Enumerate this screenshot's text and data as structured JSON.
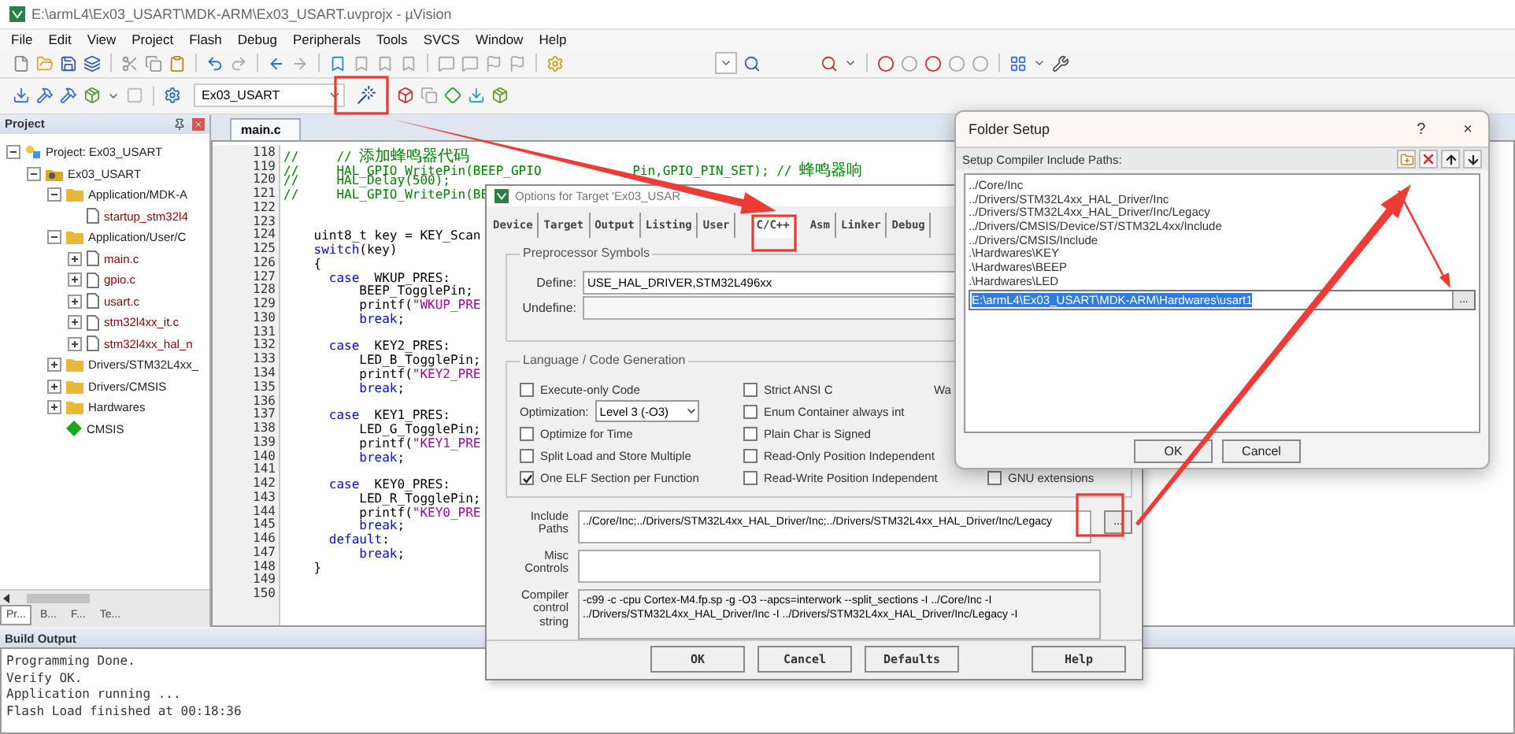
{
  "window": {
    "title": "E:\\armL4\\Ex03_USART\\MDK-ARM\\Ex03_USART.uvprojx - µVision"
  },
  "menu": [
    "File",
    "Edit",
    "View",
    "Project",
    "Flash",
    "Debug",
    "Peripherals",
    "Tools",
    "SVCS",
    "Window",
    "Help"
  ],
  "toolbar": {
    "target_select": "Ex03_USART"
  },
  "project_panel": {
    "title": "Project",
    "tree": [
      {
        "label": "Project: Ex03_USART",
        "kind": "project",
        "expanded": true,
        "children": [
          {
            "label": "Ex03_USART",
            "kind": "target",
            "expanded": true,
            "children": [
              {
                "label": "Application/MDK-A",
                "kind": "folder",
                "expanded": true,
                "children": [
                  {
                    "label": "startup_stm32l4",
                    "kind": "file"
                  }
                ]
              },
              {
                "label": "Application/User/C",
                "kind": "folder",
                "expanded": true,
                "children": [
                  {
                    "label": "main.c",
                    "kind": "file",
                    "expanded": false
                  },
                  {
                    "label": "gpio.c",
                    "kind": "file",
                    "expanded": false
                  },
                  {
                    "label": "usart.c",
                    "kind": "file",
                    "expanded": false
                  },
                  {
                    "label": "stm32l4xx_it.c",
                    "kind": "file",
                    "expanded": false
                  },
                  {
                    "label": "stm32l4xx_hal_n",
                    "kind": "file",
                    "expanded": false
                  }
                ]
              },
              {
                "label": "Drivers/STM32L4xx_",
                "kind": "folder",
                "expanded": false
              },
              {
                "label": "Drivers/CMSIS",
                "kind": "folder",
                "expanded": false
              },
              {
                "label": "Hardwares",
                "kind": "folder",
                "expanded": false
              },
              {
                "label": "CMSIS",
                "kind": "component"
              }
            ]
          }
        ]
      }
    ],
    "tabs": [
      {
        "label": "Pr...",
        "selected": true
      },
      {
        "label": "B...",
        "selected": false
      },
      {
        "label": "F...",
        "selected": false
      },
      {
        "label": "Te...",
        "selected": false
      }
    ]
  },
  "editor": {
    "tabs": [
      {
        "label": "main.c",
        "selected": true
      }
    ],
    "lines": [
      {
        "number": "118",
        "segments": [
          {
            "text": "//     // ",
            "kind": "comment"
          },
          {
            "text": "添加蜂鸣器代码",
            "kind": "cjk_comment"
          }
        ]
      },
      {
        "number": "119",
        "segments": [
          {
            "text": "//     HAL_GPIO_WritePin(BEEP_GPIO",
            "kind": "comment"
          },
          {
            "text": "           _Pin,GPIO_PIN_SET); // ",
            "kind": "comment"
          },
          {
            "text": "蜂鸣器响",
            "kind": "cjk_comment"
          }
        ]
      },
      {
        "number": "120",
        "segments": [
          {
            "text": "//     HAL_Delay(500);",
            "kind": "comment"
          }
        ]
      },
      {
        "number": "121",
        "segments": [
          {
            "text": "//     HAL_GPIO_WritePin(BE",
            "kind": "comment"
          }
        ]
      },
      {
        "number": "122"
      },
      {
        "number": "123"
      },
      {
        "number": "124",
        "segments": [
          {
            "text": "    uint8_t key = KEY_Scan",
            "kind": "plain"
          }
        ]
      },
      {
        "number": "125",
        "segments": [
          {
            "text": "    switch",
            "kind": "keyword"
          },
          {
            "text": "(key)",
            "kind": "plain"
          }
        ]
      },
      {
        "number": "126",
        "segments": [
          {
            "text": "    {",
            "kind": "plain"
          }
        ]
      },
      {
        "number": "127",
        "segments": [
          {
            "text": "      case",
            "kind": "keyword"
          },
          {
            "text": "  WKUP_PRES:",
            "kind": "plain"
          }
        ]
      },
      {
        "number": "128",
        "segments": [
          {
            "text": "          BEEP_TogglePin;",
            "kind": "plain"
          }
        ]
      },
      {
        "number": "129",
        "segments": [
          {
            "text": "          printf(",
            "kind": "plain"
          },
          {
            "text": "\"WKUP_PRE",
            "kind": "string"
          }
        ]
      },
      {
        "number": "130",
        "segments": [
          {
            "text": "          break",
            "kind": "keyword"
          },
          {
            "text": ";",
            "kind": "plain"
          }
        ]
      },
      {
        "number": "131"
      },
      {
        "number": "132",
        "segments": [
          {
            "text": "      case",
            "kind": "keyword"
          },
          {
            "text": "  KEY2_PRES:",
            "kind": "plain"
          }
        ]
      },
      {
        "number": "133",
        "segments": [
          {
            "text": "          LED_B_TogglePin;",
            "kind": "plain"
          }
        ]
      },
      {
        "number": "134",
        "segments": [
          {
            "text": "          printf(",
            "kind": "plain"
          },
          {
            "text": "\"KEY2_PRE",
            "kind": "string"
          }
        ]
      },
      {
        "number": "135",
        "segments": [
          {
            "text": "          break",
            "kind": "keyword"
          },
          {
            "text": ";",
            "kind": "plain"
          }
        ]
      },
      {
        "number": "136"
      },
      {
        "number": "137",
        "segments": [
          {
            "text": "      case",
            "kind": "keyword"
          },
          {
            "text": "  KEY1_PRES:",
            "kind": "plain"
          }
        ]
      },
      {
        "number": "138",
        "segments": [
          {
            "text": "          LED_G_TogglePin;",
            "kind": "plain"
          }
        ]
      },
      {
        "number": "139",
        "segments": [
          {
            "text": "          printf(",
            "kind": "plain"
          },
          {
            "text": "\"KEY1_PRE",
            "kind": "string"
          }
        ]
      },
      {
        "number": "140",
        "segments": [
          {
            "text": "          break",
            "kind": "keyword"
          },
          {
            "text": ";",
            "kind": "plain"
          }
        ]
      },
      {
        "number": "141"
      },
      {
        "number": "142",
        "segments": [
          {
            "text": "      case",
            "kind": "keyword"
          },
          {
            "text": "  KEY0_PRES:",
            "kind": "plain"
          }
        ]
      },
      {
        "number": "143",
        "segments": [
          {
            "text": "          LED_R_TogglePin;",
            "kind": "plain"
          }
        ]
      },
      {
        "number": "144",
        "segments": [
          {
            "text": "          printf(",
            "kind": "plain"
          },
          {
            "text": "\"KEY0_PRE",
            "kind": "string"
          }
        ]
      },
      {
        "number": "145",
        "segments": [
          {
            "text": "          break",
            "kind": "keyword"
          },
          {
            "text": ";",
            "kind": "plain"
          }
        ]
      },
      {
        "number": "146",
        "segments": [
          {
            "text": "      default",
            "kind": "keyword"
          },
          {
            "text": ":",
            "kind": "plain"
          }
        ]
      },
      {
        "number": "147",
        "segments": [
          {
            "text": "          break",
            "kind": "keyword"
          },
          {
            "text": ";",
            "kind": "plain"
          }
        ]
      },
      {
        "number": "148",
        "segments": [
          {
            "text": "    }",
            "kind": "plain"
          }
        ]
      },
      {
        "number": "149"
      },
      {
        "number": "150"
      }
    ]
  },
  "build_output": {
    "title": "Build Output",
    "lines": [
      "Programming Done.",
      "Verify OK.",
      "Application running ...",
      "Flash Load finished at 00:18:36"
    ]
  },
  "options_dialog": {
    "title": "Options for Target 'Ex03_USAR",
    "tabs": [
      {
        "label": "Device",
        "selected": false
      },
      {
        "label": "Target",
        "selected": false
      },
      {
        "label": "Output",
        "selected": false
      },
      {
        "label": "Listing",
        "selected": false
      },
      {
        "label": "User",
        "selected": false
      },
      {
        "label": "C/C++",
        "selected": true
      },
      {
        "label": "Asm",
        "selected": false
      },
      {
        "label": "Linker",
        "selected": false
      },
      {
        "label": "Debug",
        "selected": false
      }
    ],
    "preprocessor": {
      "title": "Preprocessor Symbols",
      "define_label": "Define:",
      "define": "USE_HAL_DRIVER,STM32L496xx",
      "undefine_label": "Undefine:"
    },
    "codegen": {
      "title": "Language / Code Generation",
      "left": [
        {
          "kind": "checkbox",
          "label": "Execute-only Code",
          "checked": false
        },
        {
          "kind": "select",
          "label": "Optimization:",
          "value": "Level 3 (-O3)"
        },
        {
          "kind": "checkbox",
          "label": "Optimize for Time",
          "checked": false
        },
        {
          "kind": "checkbox",
          "label": "Split Load and Store Multiple",
          "checked": false
        },
        {
          "kind": "checkbox",
          "label": "One ELF Section per Function",
          "checked": true
        }
      ],
      "right": [
        {
          "kind": "checkbox",
          "label": "Strict ANSI C",
          "checked": false
        },
        {
          "kind": "checkbox",
          "label": "Enum Container always int",
          "checked": false
        },
        {
          "kind": "checkbox",
          "label": "Plain Char is Signed",
          "checked": false
        },
        {
          "kind": "checkbox",
          "label": "Read-Only Position Independent",
          "checked": false
        },
        {
          "kind": "checkbox",
          "label": "Read-Write Position Independent",
          "checked": false
        }
      ],
      "warnings_label": "Wa",
      "gnu": {
        "label": "GNU extensions",
        "checked": false
      }
    },
    "include_label": "Include Paths",
    "include_value": "../Core/Inc;../Drivers/STM32L4xx_HAL_Driver/Inc;../Drivers/STM32L4xx_HAL_Driver/Inc/Legacy",
    "browse": "...",
    "misc_label": "Misc Controls",
    "compiler_label": "Compiler control string",
    "compiler_lines": [
      "-c99 -c -cpu Cortex-M4.fp.sp -g -O3 --apcs=interwork --split_sections -I ../Core/Inc -I",
      "../Drivers/STM32L4xx_HAL_Driver/Inc -I ../Drivers/STM32L4xx_HAL_Driver/Inc/Legacy -I"
    ],
    "buttons": [
      "OK",
      "Cancel",
      "Defaults",
      "Help"
    ]
  },
  "folder_setup": {
    "title": "Folder Setup",
    "help": "?",
    "close": "×",
    "label": "Setup Compiler Include Paths:",
    "paths": [
      {
        "text": "../Core/Inc",
        "selected": false
      },
      {
        "text": "../Drivers/STM32L4xx_HAL_Driver/Inc",
        "selected": false
      },
      {
        "text": "../Drivers/STM32L4xx_HAL_Driver/Inc/Legacy",
        "selected": false
      },
      {
        "text": "../Drivers/CMSIS/Device/ST/STM32L4xx/Include",
        "selected": false
      },
      {
        "text": "../Drivers/CMSIS/Include",
        "selected": false
      },
      {
        "text": ".\\Hardwares\\KEY",
        "selected": false
      },
      {
        "text": ".\\Hardwares\\BEEP",
        "selected": false
      },
      {
        "text": ".\\Hardwares\\LED",
        "selected": false
      },
      {
        "text": "E:\\armL4\\Ex03_USART\\MDK-ARM\\Hardwares\\usart1",
        "selected": true
      }
    ],
    "browse": "...",
    "buttons": [
      "OK",
      "Cancel"
    ]
  }
}
